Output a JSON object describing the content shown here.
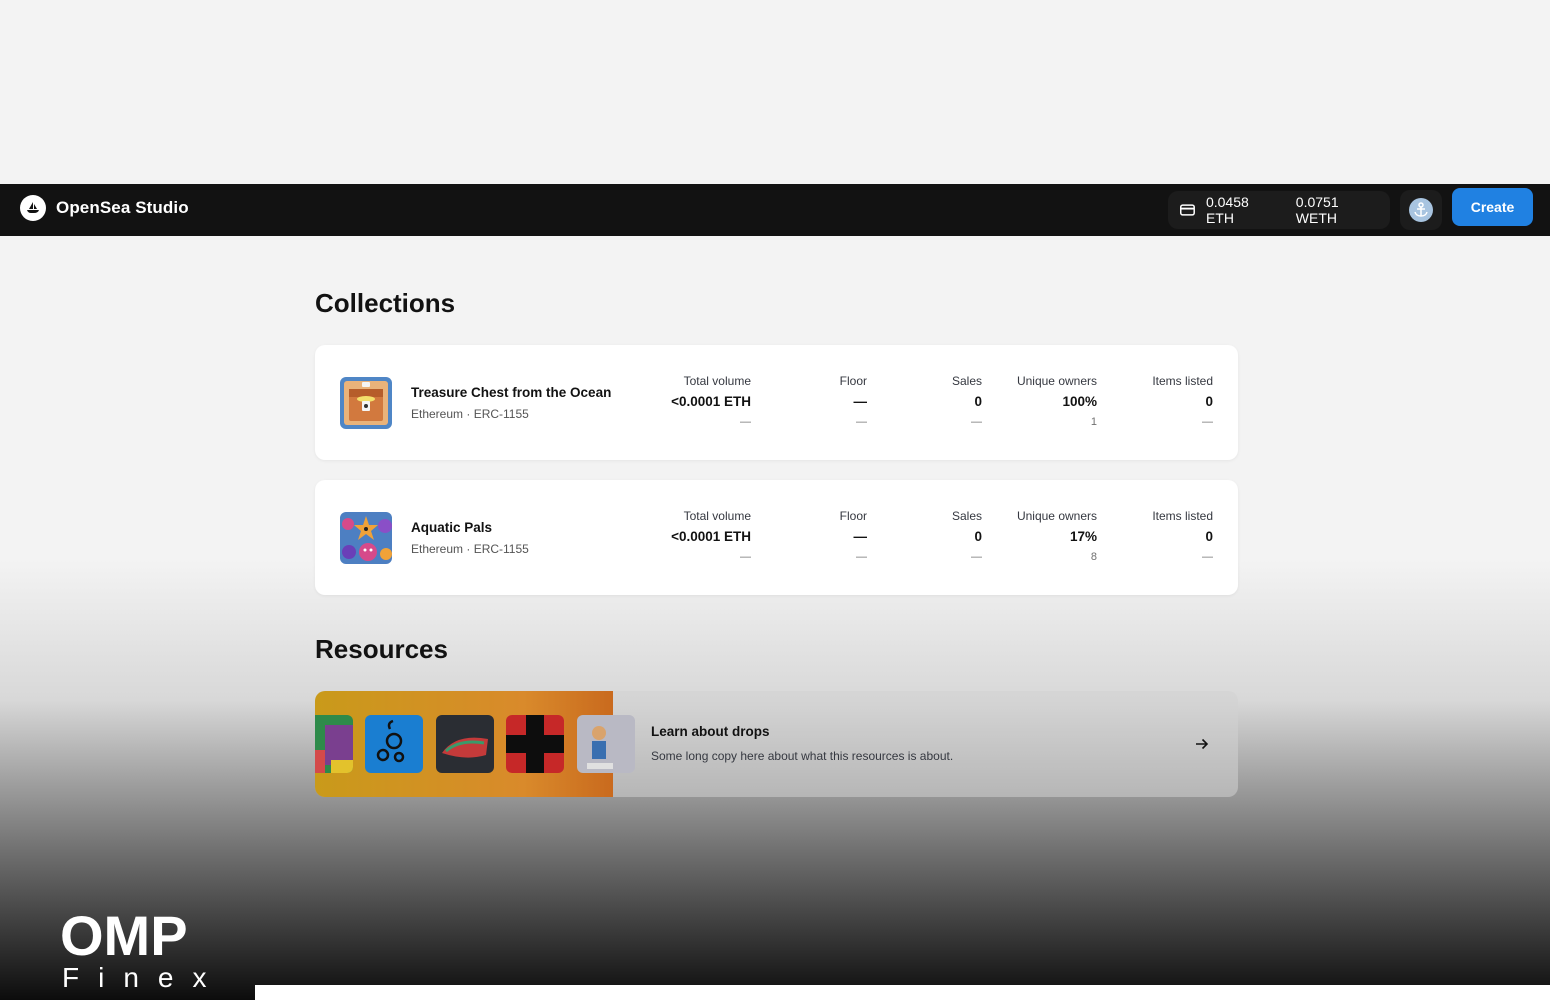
{
  "header": {
    "app_title": "OpenSea Studio",
    "eth_balance": "0.0458 ETH",
    "weth_balance": "0.0751 WETH",
    "create_label": "Create"
  },
  "collections": {
    "title": "Collections",
    "items": [
      {
        "name": "Treasure Chest from the Ocean",
        "subtitle": "Ethereum · ERC-1155",
        "stats": [
          {
            "label": "Total volume",
            "value": "<0.0001 ETH",
            "sub": "—"
          },
          {
            "label": "Floor",
            "value": "—",
            "sub": "—"
          },
          {
            "label": "Sales",
            "value": "0",
            "sub": "—"
          },
          {
            "label": "Unique owners",
            "value": "100%",
            "sub": "1"
          },
          {
            "label": "Items listed",
            "value": "0",
            "sub": "—"
          }
        ]
      },
      {
        "name": "Aquatic Pals",
        "subtitle": "Ethereum · ERC-1155",
        "stats": [
          {
            "label": "Total volume",
            "value": "<0.0001 ETH",
            "sub": "—"
          },
          {
            "label": "Floor",
            "value": "—",
            "sub": "—"
          },
          {
            "label": "Sales",
            "value": "0",
            "sub": "—"
          },
          {
            "label": "Unique owners",
            "value": "17%",
            "sub": "8"
          },
          {
            "label": "Items listed",
            "value": "0",
            "sub": "—"
          }
        ]
      }
    ]
  },
  "resources": {
    "title": "Resources",
    "card_title": "Learn about drops",
    "card_desc": "Some long copy here about what this resources is about."
  },
  "watermark": {
    "line1": "OMP",
    "line2": "Finex"
  },
  "colors": {
    "accent": "#2081e2",
    "topbar": "#121212"
  }
}
